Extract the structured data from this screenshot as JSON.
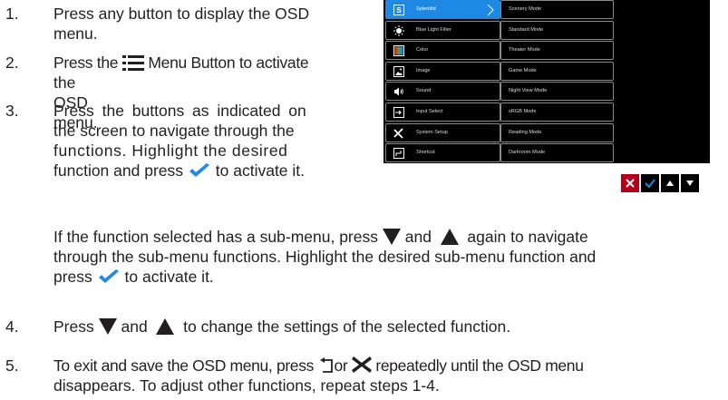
{
  "steps": [
    {
      "num": "1.",
      "lines": [
        "Press any button to display the OSD",
        "menu."
      ]
    },
    {
      "num": "2.",
      "line1_pre": "Press the",
      "line1_post": "Menu Button to activate",
      "line2": "the OSD menu."
    },
    {
      "num": "3.",
      "lines": [
        "Press the buttons as indicated on",
        "the screen to navigate through the",
        "functions. Highlight the desired"
      ],
      "line4_pre": "function and press",
      "line4_post": "to activate it."
    },
    {
      "num": "4.",
      "pre": "Press",
      "mid": "and",
      "post": "to change the settings of the selected function."
    },
    {
      "num": "5.",
      "pre": "To exit and save the OSD menu, press",
      "mid": "or",
      "post": "repeatedly until the OSD menu",
      "line2": "disappears. To adjust other functions, repeat steps 1-4."
    }
  ],
  "sub_paragraph": {
    "line1_pre": "If the function selected has a sub-menu, press",
    "line1_mid": "and",
    "line1_post": "again to navigate",
    "line2": "through the sub-menu functions. Highlight the desired sub-menu function and",
    "line3_pre": "press",
    "line3_post": "to activate it."
  },
  "osd": {
    "main_menu": [
      {
        "label": "Splendid",
        "icon": "splendid-icon"
      },
      {
        "label": "Blue Light Filter",
        "icon": "blue-light-icon"
      },
      {
        "label": "Color",
        "icon": "color-icon"
      },
      {
        "label": "Image",
        "icon": "image-icon"
      },
      {
        "label": "Sound",
        "icon": "sound-icon"
      },
      {
        "label": "Input Select",
        "icon": "input-select-icon"
      },
      {
        "label": "System Setup",
        "icon": "system-setup-icon"
      },
      {
        "label": "Shortcut",
        "icon": "shortcut-icon"
      }
    ],
    "sub_menu": [
      "Scenery Mode",
      "Standard Mode",
      "Theater Mode",
      "Game Mode",
      "Night View Mode",
      "sRGB Mode",
      "Reading Mode",
      "Darkroom Mode"
    ],
    "selected_index": 0,
    "buttons": [
      "close-icon",
      "checkmark-icon",
      "up-arrow-icon",
      "down-arrow-icon"
    ],
    "colors": {
      "highlight": "#1e88e5",
      "check": "#1e88e5",
      "close_bg": "#b3001a"
    }
  }
}
